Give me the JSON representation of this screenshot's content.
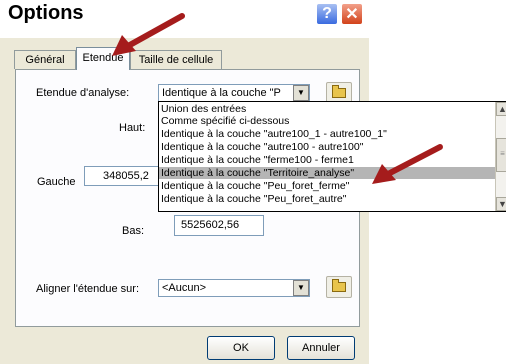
{
  "dialog": {
    "title": "Options",
    "help_label": "?",
    "close_label": "✕"
  },
  "tabs": {
    "general": "Général",
    "etendue": "Etendue",
    "taille": "Taille de cellule"
  },
  "form": {
    "etendue_label": "Etendue d'analyse:",
    "etendue_value": "Identique à la couche \"P",
    "haut_label": "Haut:",
    "gauche_label": "Gauche",
    "gauche_value": "348055,2",
    "bas_label": "Bas:",
    "bas_value": "5525602,56",
    "aligner_label": "Aligner l'étendue sur:",
    "aligner_value": "<Aucun>"
  },
  "dropdown": {
    "items": [
      "Union des entrées",
      "Comme spécifié ci-dessous",
      "Identique à la couche \"autre100_1 - autre100_1\"",
      "Identique à la couche \"autre100 - autre100\"",
      "Identique à la couche \"ferme100 - ferme1",
      "Identique à la couche \"Territoire_analyse\"",
      "Identique à la couche \"Peu_foret_ferme\"",
      "Identique à la couche \"Peu_foret_autre\""
    ],
    "selected_index": 5
  },
  "buttons": {
    "ok": "OK",
    "cancel": "Annuler"
  },
  "colors": {
    "annotation_arrow": "#a51c1c",
    "selection": "#b5b5b5",
    "dialog_face": "#ece9d8"
  }
}
